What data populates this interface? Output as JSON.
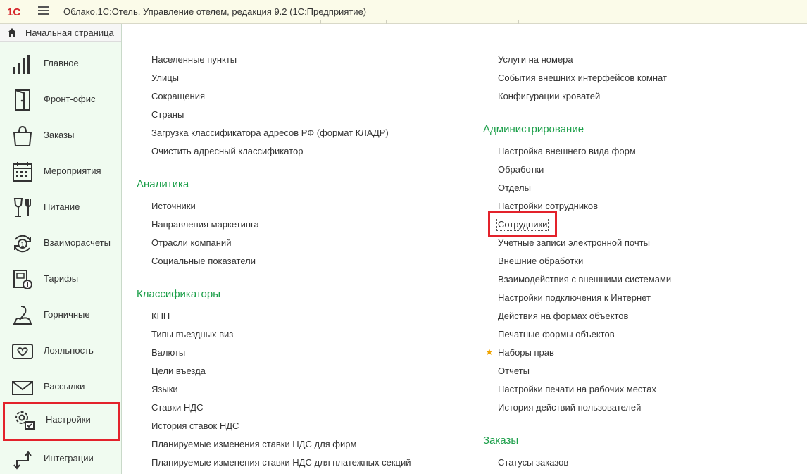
{
  "app": {
    "title": "Облако.1С:Отель. Управление отелем, редакция 9.2  (1С:Предприятие)",
    "logo": "1С",
    "menu_icon": "hamburger-menu-icon"
  },
  "sidebar": {
    "home_label": "Начальная страница",
    "items": [
      {
        "label": "Главное",
        "icon": "bar-chart-icon"
      },
      {
        "label": "Фронт-офис",
        "icon": "door-icon"
      },
      {
        "label": "Заказы",
        "icon": "shopping-bag-icon"
      },
      {
        "label": "Мероприятия",
        "icon": "calendar-icon"
      },
      {
        "label": "Питание",
        "icon": "glass-fork-icon"
      },
      {
        "label": "Взаиморасчеты",
        "icon": "settlement-cycle-icon"
      },
      {
        "label": "Тарифы",
        "icon": "tariff-document-icon"
      },
      {
        "label": "Горничные",
        "icon": "vacuum-cleaner-icon"
      },
      {
        "label": "Лояльность",
        "icon": "heart-card-icon"
      },
      {
        "label": "Рассылки",
        "icon": "envelope-icon"
      },
      {
        "label": "Настройки",
        "icon": "gears-icon",
        "selected": true
      },
      {
        "label": "Интеграции",
        "icon": "integration-arrows-icon"
      }
    ]
  },
  "content": {
    "left_column": {
      "top_links": [
        "Населенные пункты",
        "Улицы",
        "Сокращения",
        "Страны",
        "Загрузка классификатора адресов РФ (формат КЛАДР)",
        "Очистить адресный классификатор"
      ],
      "analytics": {
        "title": "Аналитика",
        "links": [
          "Источники",
          "Направления маркетинга",
          "Отрасли компаний",
          "Социальные показатели"
        ]
      },
      "classifiers": {
        "title": "Классификаторы",
        "links": [
          "КПП",
          "Типы въездных виз",
          "Валюты",
          "Цели въезда",
          "Языки",
          "Ставки НДС",
          "История ставок НДС",
          "Планируемые изменения ставки НДС для фирм",
          "Планируемые изменения ставки НДС для платежных секций"
        ]
      }
    },
    "right_column": {
      "top_links": [
        "Услуги на номера",
        "События внешних интерфейсов комнат",
        "Конфигурации кроватей"
      ],
      "administration": {
        "title": "Администрирование",
        "links": [
          "Настройка внешнего вида форм",
          "Обработки",
          "Отделы",
          "Настройки сотрудников",
          "Сотрудники",
          "Учетные записи электронной почты",
          "Внешние обработки",
          "Взаимодействия с внешними системами",
          "Настройки подключения к Интернет",
          "Действия на формах объектов",
          "Печатные формы объектов",
          "Наборы прав",
          "Отчеты",
          "Настройки печати на рабочих местах",
          "История действий пользователей"
        ],
        "favorite_icon": "star-icon",
        "highlighted": "Сотрудники"
      },
      "orders": {
        "title": "Заказы",
        "links": [
          "Статусы заказов"
        ]
      }
    },
    "colors": {
      "section_title": "#1a9e48",
      "highlight": "#e3222b",
      "sidebar_bg": "#f0fbf0",
      "titlebar_bg": "#fbfbe9",
      "star": "#f0a400"
    }
  }
}
